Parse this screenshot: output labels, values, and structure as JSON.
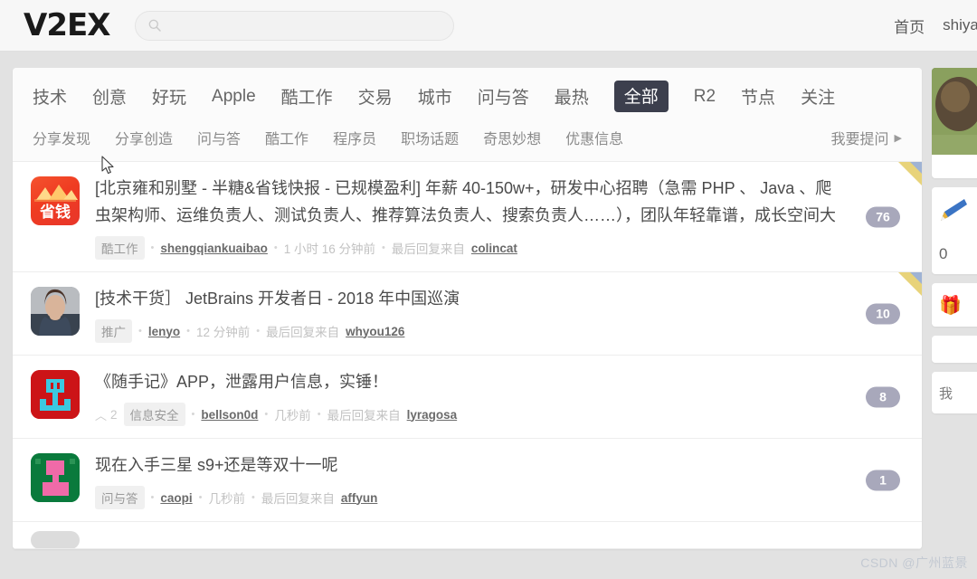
{
  "header": {
    "logo": "V2EX",
    "search_placeholder": "",
    "search_value": "",
    "search_icon": "search-icon",
    "links": [
      {
        "label": "首页"
      },
      {
        "label": "shiyanlou"
      }
    ]
  },
  "nav": {
    "primary": [
      {
        "label": "技术",
        "active": false
      },
      {
        "label": "创意",
        "active": false
      },
      {
        "label": "好玩",
        "active": false
      },
      {
        "label": "Apple",
        "active": false
      },
      {
        "label": "酷工作",
        "active": false
      },
      {
        "label": "交易",
        "active": false
      },
      {
        "label": "城市",
        "active": false
      },
      {
        "label": "问与答",
        "active": false
      },
      {
        "label": "最热",
        "active": false
      },
      {
        "label": "全部",
        "active": true
      },
      {
        "label": "R2",
        "active": false
      },
      {
        "label": "节点",
        "active": false
      },
      {
        "label": "关注",
        "active": false
      }
    ],
    "secondary": [
      {
        "label": "分享发现"
      },
      {
        "label": "分享创造"
      },
      {
        "label": "问与答"
      },
      {
        "label": "酷工作"
      },
      {
        "label": "程序员"
      },
      {
        "label": "职场话题"
      },
      {
        "label": "奇思妙想"
      },
      {
        "label": "优惠信息"
      }
    ],
    "ask_label": "我要提问",
    "ask_caret": "▶"
  },
  "topics": [
    {
      "title": "[北京雍和别墅 - 半糖&省钱快报 - 已规模盈利] 年薪 40-150w+，研发中心招聘（急需 PHP 、 Java 、爬虫架构师、运维负责人、测试负责人、推荐算法负责人、搜索负责人……），团队年轻靠谱，成长空间大",
      "node": "酷工作",
      "author": "shengqiankuaibao",
      "time": "1 小时 16 分钟前",
      "reply_prefix": "最后回复来自",
      "last_reply": "colincat",
      "count": "76",
      "votes": null,
      "avatar": "shengqian-avatar",
      "avatar_text": "省钱",
      "corner_marker": true
    },
    {
      "title": "[技术干货］ JetBrains 开发者日 -  2018 年中国巡演",
      "node": "推广",
      "author": "lenyo",
      "time": "12 分钟前",
      "reply_prefix": "最后回复来自",
      "last_reply": "whyou126",
      "count": "10",
      "votes": null,
      "avatar": "person-photo-avatar",
      "avatar_text": "",
      "corner_marker": true
    },
    {
      "title": "《随手记》APP，泄露用户信息，实锤！",
      "node": "信息安全",
      "author": "bellson0d",
      "time": "几秒前",
      "reply_prefix": "最后回复来自",
      "last_reply": "lyragosa",
      "count": "8",
      "votes": "2",
      "vote_arrow": "︿",
      "avatar": "red-pixel-avatar",
      "avatar_text": "",
      "corner_marker": false
    },
    {
      "title": "现在入手三星 s9+还是等双十一呢",
      "node": "问与答",
      "author": "caopi",
      "time": "几秒前",
      "reply_prefix": "最后回复来自",
      "last_reply": "affyun",
      "count": "1",
      "votes": null,
      "avatar": "green-pixel-avatar",
      "avatar_text": "",
      "corner_marker": false
    }
  ],
  "sidebar": {
    "cards": [
      {
        "type": "photo",
        "name": "promo-image-card"
      },
      {
        "type": "line",
        "name": "caption-line",
        "text": ""
      },
      {
        "type": "pencil",
        "name": "write-card",
        "icon": "pencil-icon"
      },
      {
        "type": "number",
        "name": "counter-card",
        "text": "0"
      },
      {
        "type": "gift",
        "name": "gift-card",
        "icon": "gift-icon"
      },
      {
        "type": "blank",
        "name": "blank-card"
      },
      {
        "type": "text",
        "name": "mine-card",
        "text": "我"
      }
    ]
  },
  "watermark": "CSDN @广州蓝景",
  "colors": {
    "accent_active": "#3c3f4d",
    "badge": "#a8a8bb",
    "page_bg": "#e2e2e2",
    "header_bg": "#f7f7f7"
  }
}
